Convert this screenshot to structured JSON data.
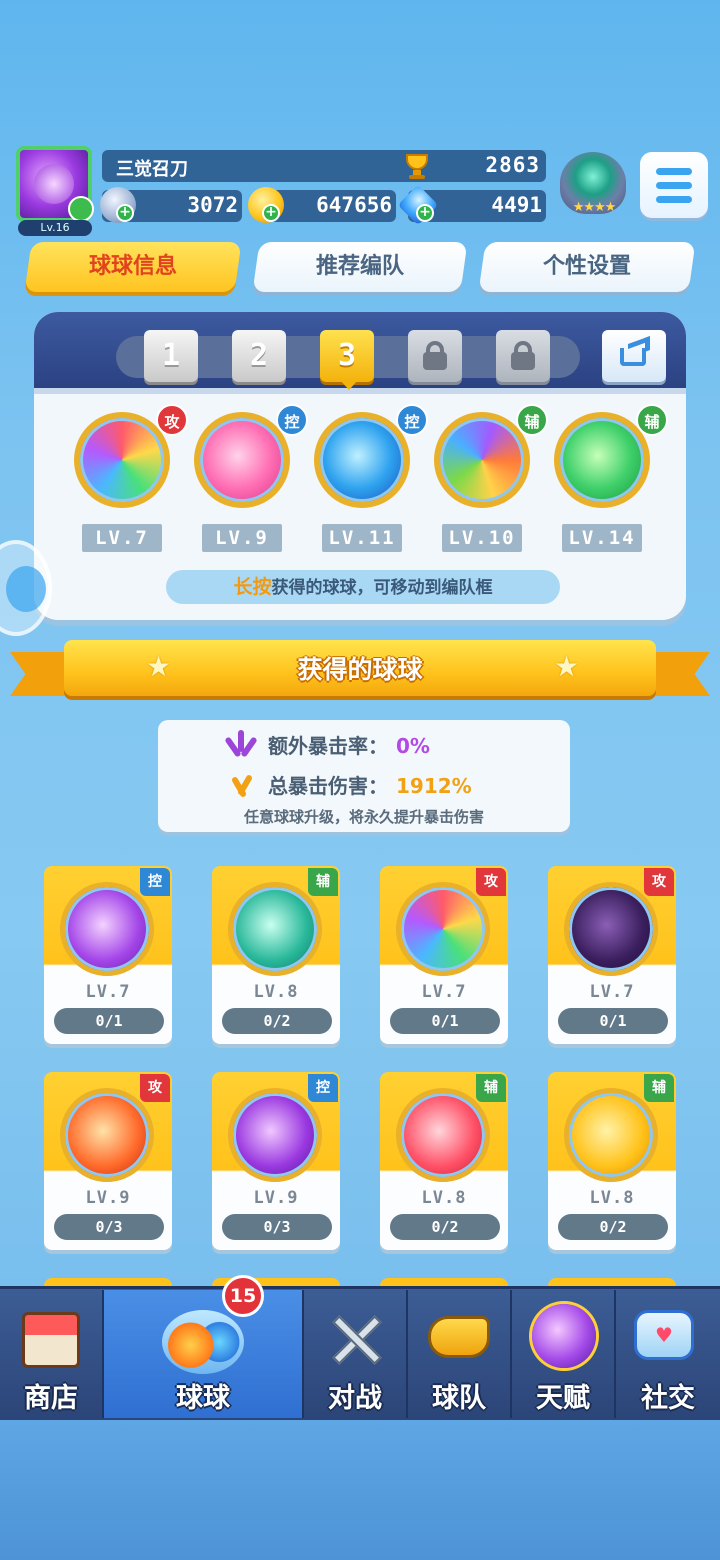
{
  "player": {
    "name": "三觉召刀",
    "level": "Lv.16",
    "trophies": "2863",
    "silver": "3072",
    "gold": "647656",
    "gems": "4491"
  },
  "tabs": [
    {
      "label": "球球信息",
      "active": true
    },
    {
      "label": "推荐编队",
      "active": false
    },
    {
      "label": "个性设置",
      "active": false
    }
  ],
  "team": {
    "slots": [
      "1",
      "2",
      "3"
    ],
    "selected_slot": "3",
    "balls": [
      {
        "tag": "攻",
        "level": "LV.7",
        "icon": "prism-ball-icon"
      },
      {
        "tag": "控",
        "level": "LV.9",
        "icon": "heart-ball-icon"
      },
      {
        "tag": "控",
        "level": "LV.11",
        "icon": "cloud-ball-icon"
      },
      {
        "tag": "辅",
        "level": "LV.10",
        "icon": "crowd-ball-icon"
      },
      {
        "tag": "辅",
        "level": "LV.14",
        "icon": "star-arrow-ball-icon"
      }
    ],
    "hint_highlight": "长按",
    "hint_text": "获得的球球，可移动到编队框"
  },
  "section": {
    "title": "获得的球球"
  },
  "crit": {
    "extra_label": "额外暴击率：",
    "extra_value": "0%",
    "total_label": "总暴击伤害：",
    "total_value": "1912%",
    "note": "任意球球升级，将永久提升暴击伤害"
  },
  "owned": [
    {
      "tag": "控",
      "level": "LV.7",
      "progress": "0/1",
      "icon": "book-ball-icon"
    },
    {
      "tag": "辅",
      "level": "LV.8",
      "progress": "0/2",
      "icon": "dragon-ball-icon"
    },
    {
      "tag": "攻",
      "level": "LV.7",
      "progress": "0/1",
      "icon": "prism-ball-icon"
    },
    {
      "tag": "攻",
      "level": "LV.7",
      "progress": "0/1",
      "icon": "venom-ball-icon"
    },
    {
      "tag": "攻",
      "level": "LV.9",
      "progress": "0/3",
      "icon": "phoenix-ball-icon"
    },
    {
      "tag": "控",
      "level": "LV.9",
      "progress": "0/3",
      "icon": "shatter-ball-icon"
    },
    {
      "tag": "辅",
      "level": "LV.8",
      "progress": "0/2",
      "icon": "gift-ball-icon"
    },
    {
      "tag": "辅",
      "level": "LV.8",
      "progress": "0/2",
      "icon": "piggy-bank-ball-icon"
    }
  ],
  "nav": {
    "badge": "15",
    "items": [
      {
        "label": "商店",
        "icon": "shop-icon"
      },
      {
        "label": "球球",
        "icon": "balls-icon",
        "active": true
      },
      {
        "label": "对战",
        "icon": "crossed-swords-icon"
      },
      {
        "label": "球队",
        "icon": "whistle-icon"
      },
      {
        "label": "天赋",
        "icon": "planet-icon"
      },
      {
        "label": "社交",
        "icon": "chat-heart-icon"
      }
    ]
  },
  "colors": {
    "attack_tag": "#e1363a",
    "control_tag": "#2f88d6",
    "support_tag": "#39a64a",
    "active_tab": "#ffc420",
    "crit_rate": "#b44ae6",
    "crit_damage": "#f2a114"
  }
}
